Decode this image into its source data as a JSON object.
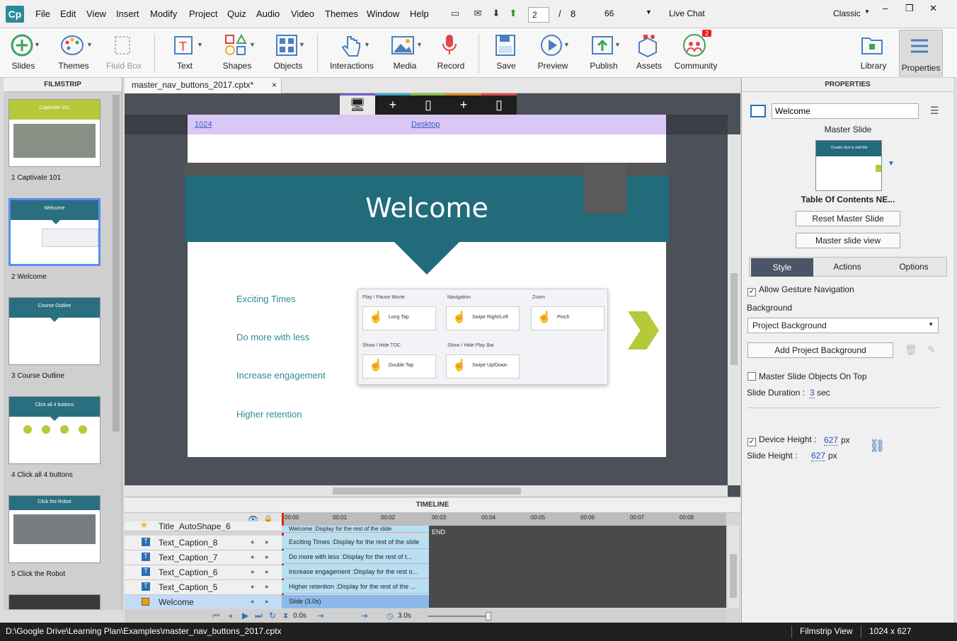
{
  "app": {
    "logo": "Cp",
    "window_controls": [
      "–",
      "❐",
      "✕"
    ]
  },
  "menu": [
    "File",
    "Edit",
    "View",
    "Insert",
    "Modify",
    "Project",
    "Quiz",
    "Audio",
    "Video",
    "Themes",
    "Window",
    "Help"
  ],
  "nav": {
    "current_slide": "2",
    "separator": "/",
    "total_slides": "8",
    "zoom": "66",
    "live_chat": "Live Chat",
    "workspace": "Classic"
  },
  "toolbar": {
    "slides": "Slides",
    "themes": "Themes",
    "fluid_box": "Fluid Box",
    "text": "Text",
    "shapes": "Shapes",
    "objects": "Objects",
    "interactions": "Interactions",
    "media": "Media",
    "record": "Record",
    "save": "Save",
    "preview": "Preview",
    "publish": "Publish",
    "assets": "Assets",
    "community": "Community",
    "community_badge": "2",
    "library": "Library",
    "properties": "Properties"
  },
  "filmstrip": {
    "header": "FILMSTRIP",
    "slides": [
      {
        "label": "1 Captivate 101",
        "title": "Captivate 101"
      },
      {
        "label": "2 Welcome",
        "title": "Welcome"
      },
      {
        "label": "3 Course Outline",
        "title": "Course Outline"
      },
      {
        "label": "4 Click all 4 buttons",
        "title": "Click all 4 buttons"
      },
      {
        "label": "5 Click the Robot",
        "title": "Click the Robot"
      }
    ]
  },
  "document": {
    "tab": "master_nav_buttons_2017.cptx*",
    "close": "×"
  },
  "ruler": {
    "width": "1024",
    "mode": "Desktop"
  },
  "slide": {
    "title": "Welcome",
    "bullets": [
      "Exciting Times",
      "Do more with less",
      "Increase engagement",
      "Higher retention"
    ],
    "gestures": {
      "play_pause": "Play / Pause Movie",
      "long_tap": "Long Tap",
      "navigation": "Navigation",
      "swipe_lr": "Swipe Right/Left",
      "zoom": "Zoom",
      "pinch": "Pinch",
      "show_hide_toc": "Show / Hide TOC",
      "double_tap": "Double Tap",
      "show_hide_playbar": "Show / Hide Play Bar",
      "swipe_ud": "Swipe Up/Down"
    }
  },
  "timeline": {
    "header": "TIMELINE",
    "ticks": [
      "00:00",
      "00:01",
      "00:02",
      "00:03",
      "00:04",
      "00:05",
      "00:06",
      "00:07",
      "00:08"
    ],
    "end_label": "END",
    "rows": [
      {
        "name": "Title_AutoShape_6",
        "bar": "Welcome :Display for the rest of the slide"
      },
      {
        "name": "Text_Caption_8",
        "bar": "Exciting Times :Display for the rest of the slide"
      },
      {
        "name": "Text_Caption_7",
        "bar": "Do more with less :Display for the rest of t..."
      },
      {
        "name": "Text_Caption_6",
        "bar": "Increase engagement :Display for the rest o..."
      },
      {
        "name": "Text_Caption_5",
        "bar": "Higher retention :Display for the rest of the ..."
      },
      {
        "name": "Welcome",
        "bar": "Slide (3.0s)"
      }
    ],
    "time_start": "0.0s",
    "time_arrows_1": "⇥",
    "time_arrows_2": "⇥",
    "duration": "3.0s"
  },
  "properties": {
    "header": "PROPERTIES",
    "name_value": "Welcome",
    "master_slide_label": "Master Slide",
    "master_thumb_title": "Double click to add title",
    "master_name": "Table Of Contents NE...",
    "reset_btn": "Reset Master Slide",
    "view_btn": "Master slide view",
    "tabs": [
      "Style",
      "Actions",
      "Options"
    ],
    "allow_gesture": "Allow Gesture Navigation",
    "background_label": "Background",
    "background_value": "Project Background",
    "add_bg_btn": "Add Project Background",
    "master_objects_on_top": "Master Slide Objects On Top",
    "slide_duration_label": "Slide Duration :",
    "slide_duration_value": "3",
    "slide_duration_unit": "sec",
    "device_height_label": "Device Height :",
    "device_height_value": "627",
    "slide_height_label": "Slide Height :",
    "slide_height_value": "627",
    "px": "px"
  },
  "status": {
    "path": "D:\\Google Drive\\Learning Plan\\Examples\\master_nav_buttons_2017.cptx",
    "view": "Filmstrip View",
    "size": "1024 x 627"
  },
  "colors": {
    "teal": "#226b7b",
    "lime": "#b5c93a",
    "accent": "#5b8def"
  }
}
